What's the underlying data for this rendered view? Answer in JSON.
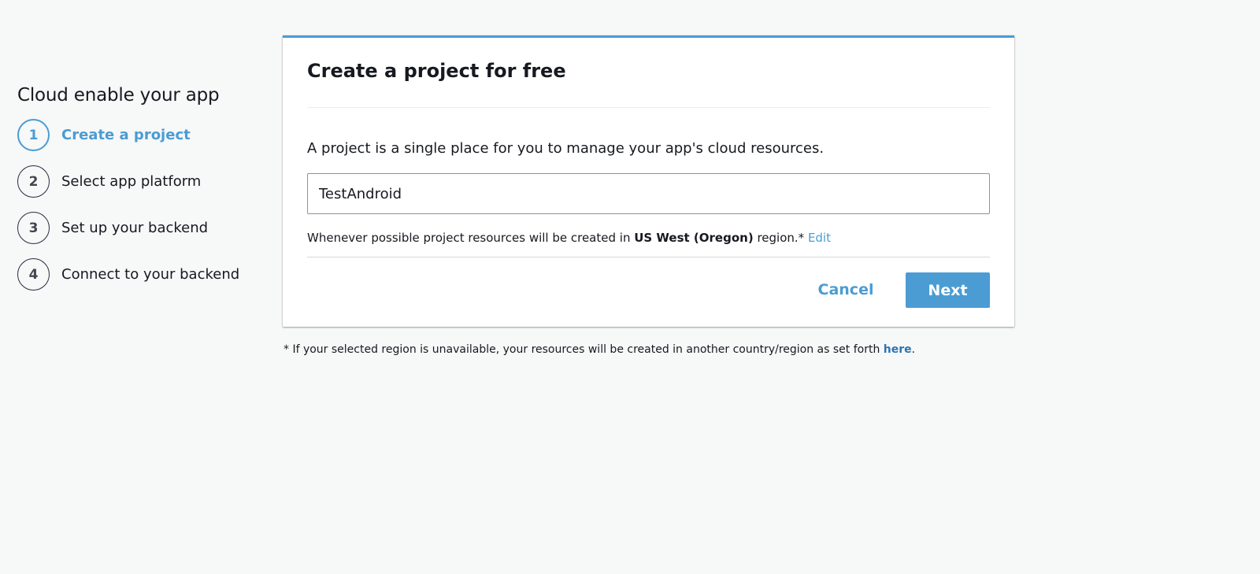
{
  "sidebar": {
    "title": "Cloud enable your app",
    "steps": [
      {
        "number": "1",
        "label": "Create a project",
        "active": true
      },
      {
        "number": "2",
        "label": "Select app platform",
        "active": false
      },
      {
        "number": "3",
        "label": "Set up your backend",
        "active": false
      },
      {
        "number": "4",
        "label": "Connect to your backend",
        "active": false
      }
    ]
  },
  "card": {
    "title": "Create a project for free",
    "description": "A project is a single place for you to manage your app's cloud resources.",
    "project_name_value": "TestAndroid",
    "region_note": {
      "prefix": "Whenever possible project resources will be created in ",
      "region": "US West (Oregon)",
      "suffix": " region.* ",
      "edit_link": "Edit"
    },
    "cancel_label": "Cancel",
    "next_label": "Next"
  },
  "footnote": {
    "text": "* If your selected region is unavailable, your resources will be created in another country/region as set forth ",
    "link": "here",
    "end": "."
  },
  "colors": {
    "accent": "#4b9cd3",
    "background": "#f7f8f8",
    "text": "#16191f"
  }
}
